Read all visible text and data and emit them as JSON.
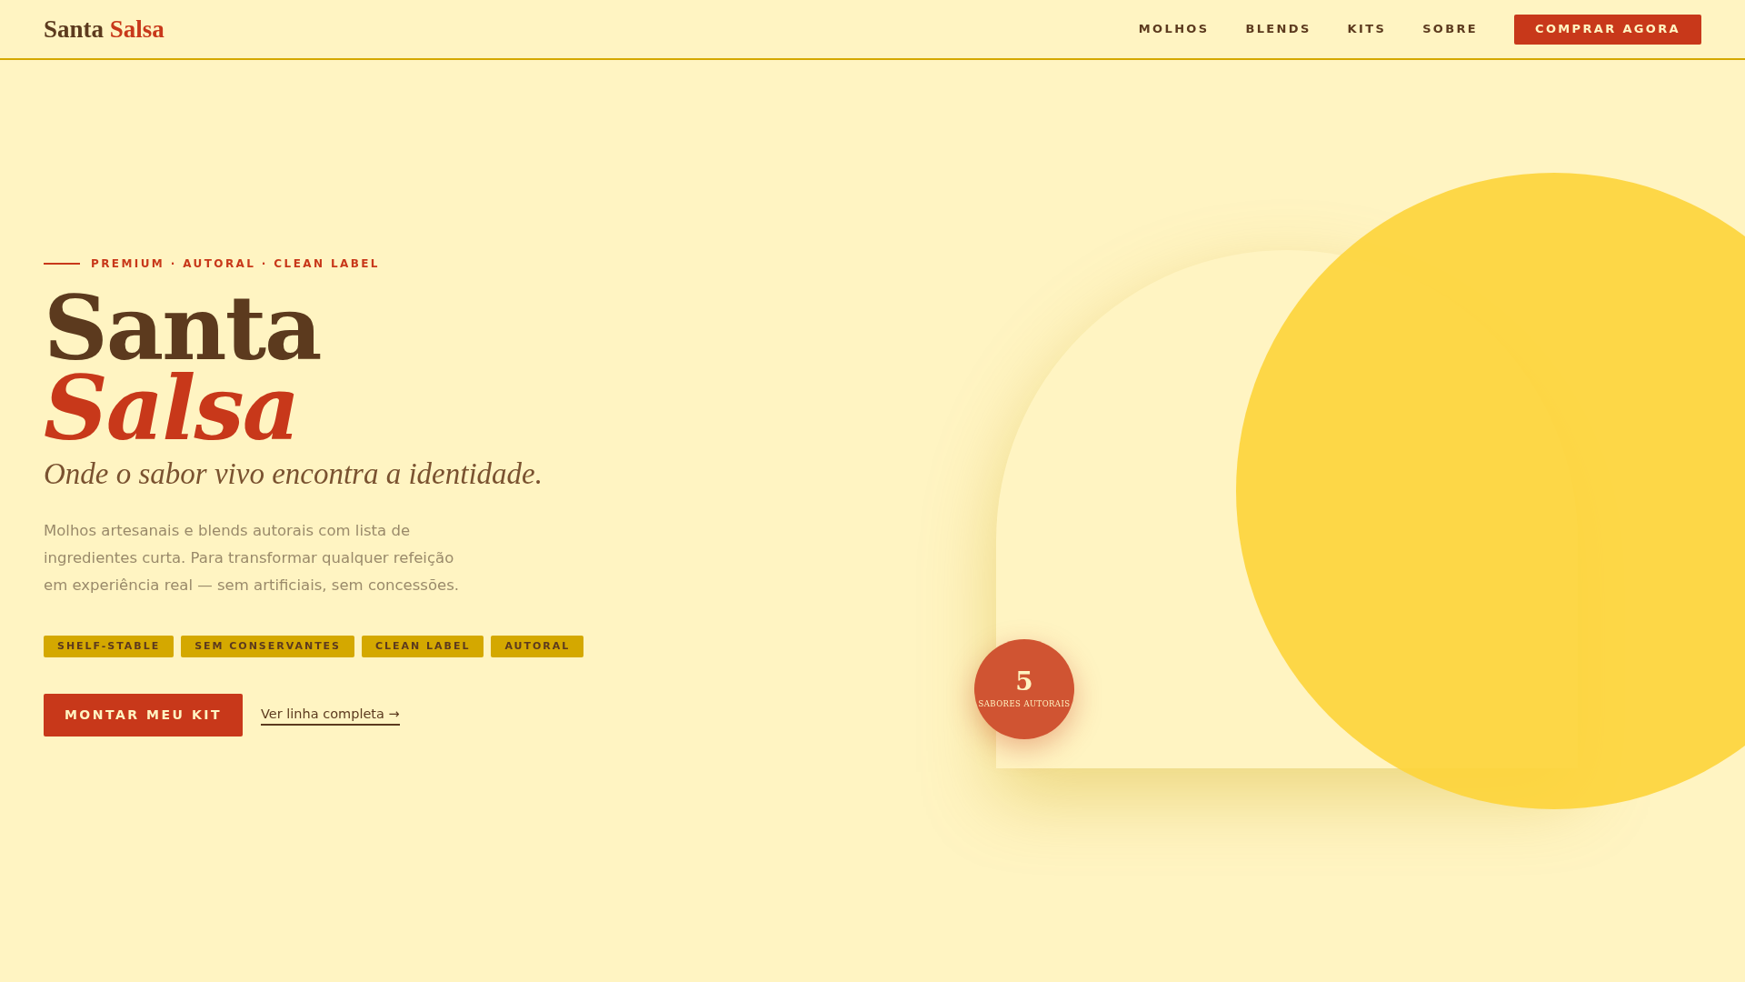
{
  "header": {
    "logo": {
      "first": "Santa",
      "second": "Salsa"
    },
    "nav": [
      "MOLHOS",
      "BLENDS",
      "KITS",
      "SOBRE"
    ],
    "cta": "COMPRAR AGORA"
  },
  "hero": {
    "eyebrow": "PREMIUM · AUTORAL · CLEAN LABEL",
    "title_line1": "Santa",
    "title_line2": "Salsa",
    "subtitle": "Onde o sabor vivo encontra a identidade.",
    "description": "Molhos artesanais e blends autorais com lista de ingredientes curta. Para transformar qualquer refeição em experiência real — sem artificiais, sem concessões.",
    "tags": [
      "SHELF-STABLE",
      "SEM CONSERVANTES",
      "CLEAN LABEL",
      "AUTORAL"
    ],
    "primary_button": "MONTAR MEU KIT",
    "secondary_link": "Ver linha completa →",
    "badge": {
      "number": "5",
      "label": "SABORES AUTORAIS"
    }
  }
}
